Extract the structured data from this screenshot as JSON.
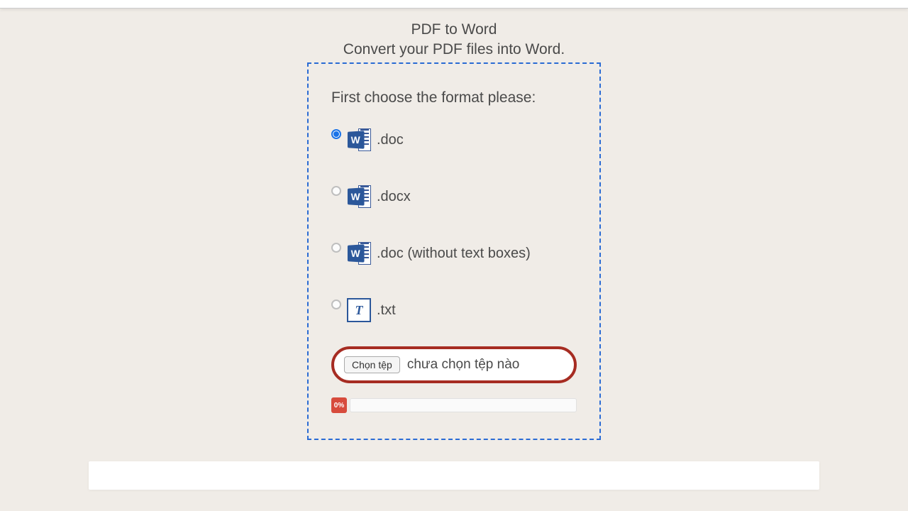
{
  "header": {
    "title": "PDF to Word",
    "subtitle": "Convert your PDF files into Word."
  },
  "form": {
    "format_label": "First choose the format please:",
    "options": [
      {
        "label": ".doc",
        "icon": "word",
        "checked": true
      },
      {
        "label": ".docx",
        "icon": "word",
        "checked": false
      },
      {
        "label": ".doc (without text boxes)",
        "icon": "word",
        "checked": false
      },
      {
        "label": ".txt",
        "icon": "txt",
        "checked": false
      }
    ],
    "upload": {
      "button_label": "Chọn tệp",
      "no_file_text": "chưa chọn tệp nào"
    },
    "progress": {
      "badge": "0%"
    }
  }
}
